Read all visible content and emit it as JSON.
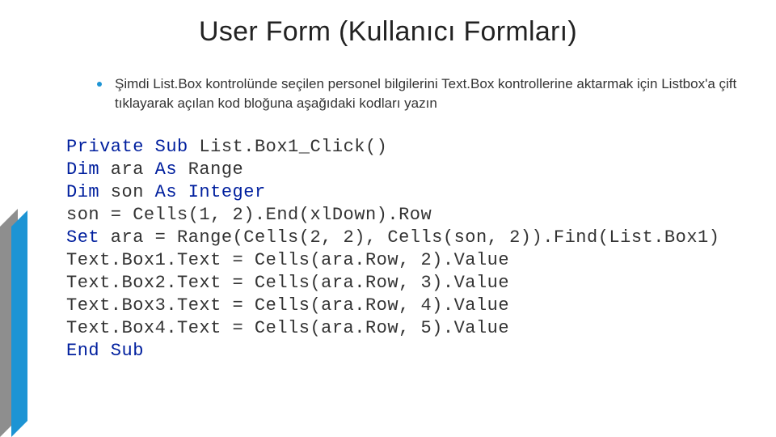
{
  "title": "User Form (Kullanıcı Formları)",
  "bullet": "Şimdi List.Box kontrolünde seçilen personel bilgilerini Text.Box kontrollerine aktarmak için Listbox'a çift tıklayarak açılan kod bloğuna aşağıdaki kodları yazın",
  "code": {
    "l1_a": "Private Sub",
    "l1_b": " List.Box1_Click()",
    "l2_a": "Dim",
    "l2_b": " ara ",
    "l2_c": "As",
    "l2_d": " Range",
    "l3_a": "Dim",
    "l3_b": " son ",
    "l3_c": "As Integer",
    "l4": "son = Cells(1, 2).End(xlDown).Row",
    "l5_a": "Set",
    "l5_b": " ara = Range(Cells(2, 2), Cells(son, 2)).Find(List.Box1)",
    "l6": "Text.Box1.Text = Cells(ara.Row, 2).Value",
    "l7": "Text.Box2.Text = Cells(ara.Row, 3).Value",
    "l8": "Text.Box3.Text = Cells(ara.Row, 4).Value",
    "l9": "Text.Box4.Text = Cells(ara.Row, 5).Value",
    "l10": "End Sub"
  }
}
